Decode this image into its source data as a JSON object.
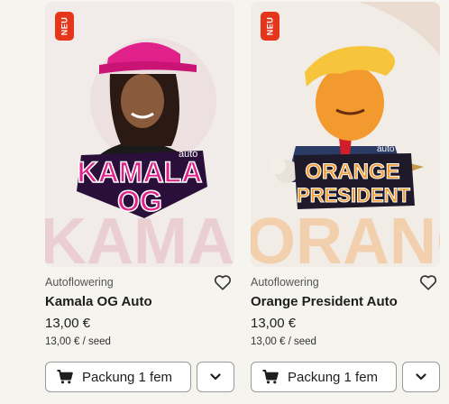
{
  "products": [
    {
      "badge": "NEU",
      "category": "Autoflowering",
      "name": "Kamala OG Auto",
      "price": "13,00 €",
      "unit_price": "13,00 € / seed",
      "pack_label": "Packung 1 fem",
      "logo_line1": "KAMALA",
      "logo_line2": "OG",
      "logo_tag": "auto",
      "bg_text": "KAMAL"
    },
    {
      "badge": "NEU",
      "category": "Autoflowering",
      "name": "Orange President Auto",
      "price": "13,00 €",
      "unit_price": "13,00 € / seed",
      "pack_label": "Packung 1 fem",
      "logo_line1": "ORANGE",
      "logo_line2": "PRESIDENT",
      "logo_tag": "auto",
      "bg_text": "ORANG"
    }
  ],
  "icons": {
    "wishlist": "heart-outline-icon",
    "cart": "shopping-cart-icon",
    "dropdown": "chevron-down-icon"
  },
  "colors": {
    "badge": "#e5361b",
    "kamala_pink": "#e0218a",
    "orange_president": "#f29a2e"
  }
}
